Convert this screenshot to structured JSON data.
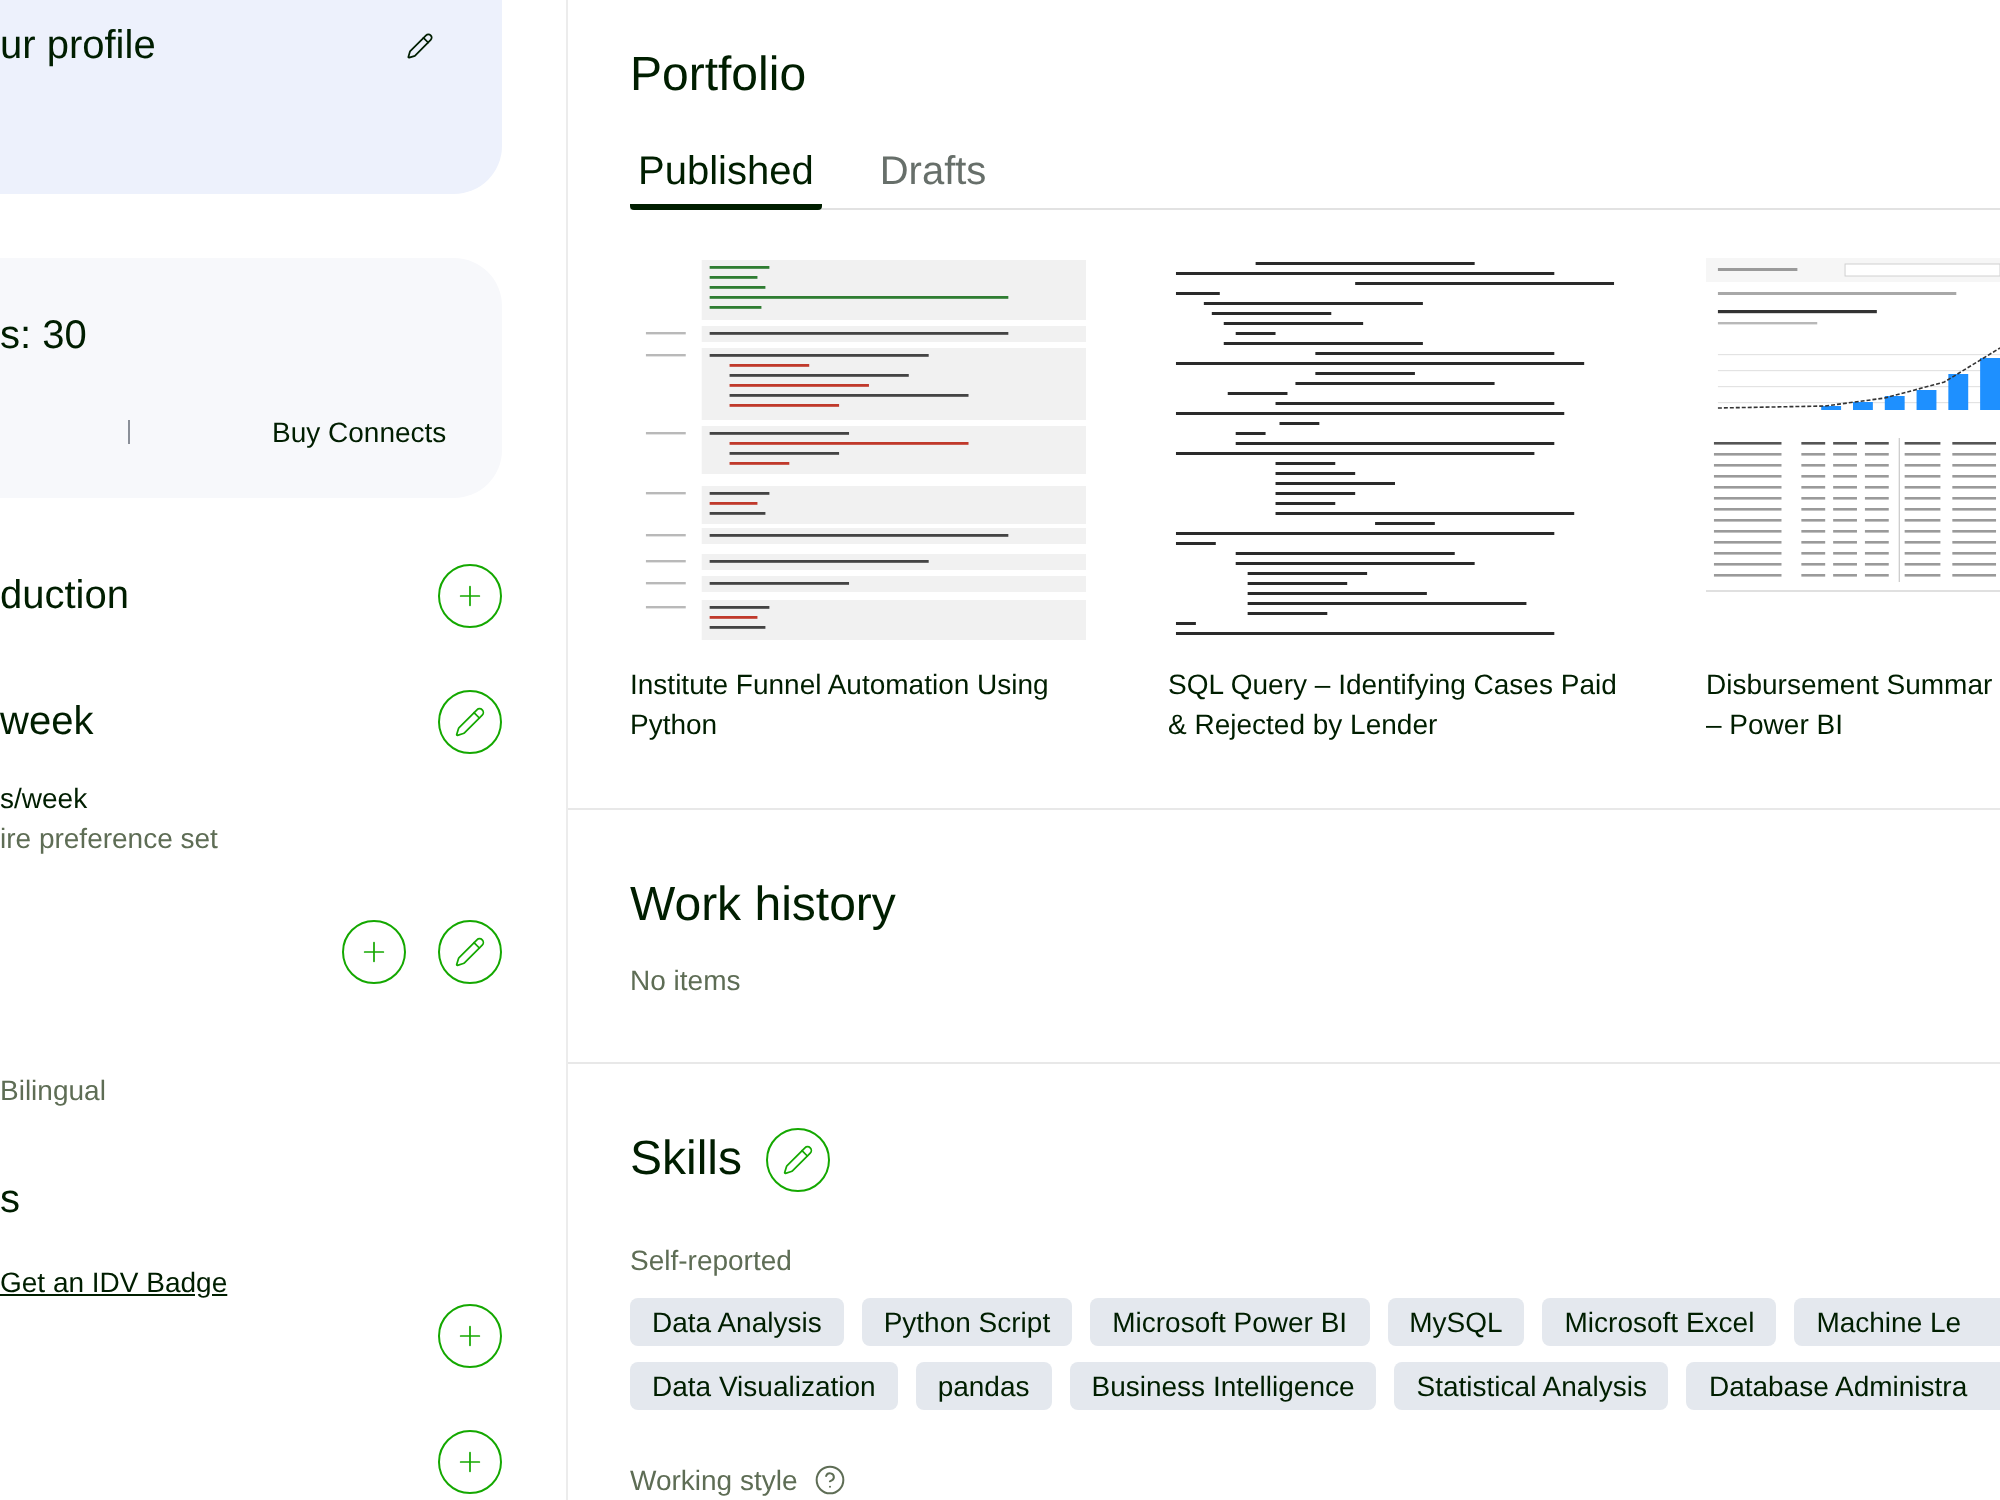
{
  "profile_card": {
    "title": "ur profile"
  },
  "connects_card": {
    "balance": "s: 30",
    "link": "Buy Connects"
  },
  "sidebar": [
    {
      "kind": "heading",
      "text": "duction",
      "actions": [
        {
          "kind": "add"
        }
      ]
    },
    {
      "kind": "heading",
      "text": "week",
      "actions": [
        {
          "kind": "edit"
        }
      ]
    },
    {
      "kind": "text",
      "text": "s/week",
      "muted": false
    },
    {
      "kind": "text",
      "text": "ire preference set",
      "muted": true
    },
    {
      "kind": "actions",
      "actions": [
        {
          "kind": "add"
        },
        {
          "kind": "edit"
        }
      ]
    },
    {
      "kind": "text",
      "text": "Bilingual",
      "muted": true
    },
    {
      "kind": "heading",
      "text": "s"
    },
    {
      "kind": "link",
      "text": "Get an IDV Badge"
    },
    {
      "kind": "actions",
      "actions": [
        {
          "kind": "add"
        }
      ]
    },
    {
      "kind": "actions",
      "actions": [
        {
          "kind": "add"
        }
      ]
    }
  ],
  "portfolio": {
    "title": "Portfolio",
    "tabs": [
      {
        "label": "Published",
        "selected": true
      },
      {
        "label": "Drafts",
        "selected": false
      }
    ],
    "items": [
      {
        "kind": "notebook",
        "title_lines": [
          "Institute Funnel Automation Using",
          "Python"
        ]
      },
      {
        "kind": "sql",
        "title_lines": [
          "SQL Query – Identifying Cases Paid",
          "& Rejected by Lender"
        ]
      },
      {
        "kind": "dashboard",
        "title_lines": [
          "Disbursement Summar",
          "– Power BI"
        ]
      }
    ]
  },
  "work_history": {
    "title": "Work history",
    "empty_text": "No items"
  },
  "skills": {
    "title": "Skills",
    "group_label": "Self-reported",
    "chip_rows": [
      [
        "Data Analysis",
        "Python Script",
        "Microsoft Power BI",
        "MySQL",
        "Microsoft Excel",
        "Machine Le"
      ],
      [
        "Data Visualization",
        "pandas",
        "Business Intelligence",
        "Statistical Analysis",
        "Database Administra"
      ]
    ],
    "next_label": "Working style"
  }
}
